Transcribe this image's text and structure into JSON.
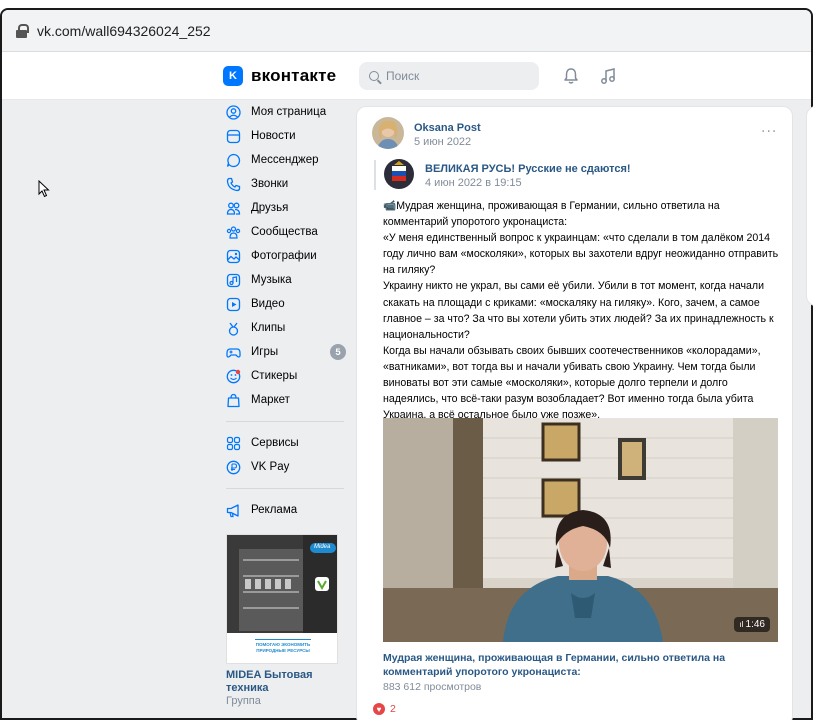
{
  "browser": {
    "url": "vk.com/wall694326024_252"
  },
  "header": {
    "logo_mark": "K",
    "logo_text": "вконтакте",
    "search_placeholder": "Поиск"
  },
  "sidebar": {
    "items": [
      {
        "label": "Моя страница",
        "icon": "user-circle-icon"
      },
      {
        "label": "Новости",
        "icon": "news-icon"
      },
      {
        "label": "Мессенджер",
        "icon": "chat-bubble-icon"
      },
      {
        "label": "Звонки",
        "icon": "phone-icon"
      },
      {
        "label": "Друзья",
        "icon": "friends-icon"
      },
      {
        "label": "Сообщества",
        "icon": "communities-icon"
      },
      {
        "label": "Фотографии",
        "icon": "photo-icon"
      },
      {
        "label": "Музыка",
        "icon": "music-icon"
      },
      {
        "label": "Видео",
        "icon": "video-icon"
      },
      {
        "label": "Клипы",
        "icon": "clips-icon"
      },
      {
        "label": "Игры",
        "icon": "gamepad-icon",
        "badge": "5"
      },
      {
        "label": "Стикеры",
        "icon": "sticker-icon"
      },
      {
        "label": "Маркет",
        "icon": "shopping-bag-icon"
      }
    ],
    "items2": [
      {
        "label": "Сервисы",
        "icon": "services-icon"
      },
      {
        "label": "VK Pay",
        "icon": "vkpay-icon"
      }
    ],
    "items3": [
      {
        "label": "Реклама",
        "icon": "megaphone-icon"
      }
    ],
    "ad": {
      "brand": "Midea",
      "slogan": "ПОМОГАЮ ЭКОНОМИТЬ ПРИРОДНЫЕ РЕСУРСЫ",
      "title": "MIDEA Бытовая техника",
      "subtitle": "Группа"
    }
  },
  "post": {
    "author": "Oksana Post",
    "date": "5 июн 2022",
    "more": "···",
    "repost": {
      "source": "ВЕЛИКАЯ РУСЬ! Русские не сдаются!",
      "date": "4 июн 2022 в 19:15"
    },
    "paragraphs": [
      "📹Мудрая женщина, проживающая в Германии, сильно ответила на комментарий упоротого укронациста:",
      "«У меня единственный вопрос к украинцам: «что сделали в том далёком 2014 году лично вам «москоляки», которых вы захотели вдруг неожиданно отправить на гиляку?",
      "Украину никто не украл, вы сами её убили. Убили в тот момент, когда начали скакать на площади с криками: «москаляку на гиляку». Кого, зачем, а самое главное – за что? За что вы хотели убить этих людей? За их принадлежность к национальности?",
      "Когда вы начали обзывать своих бывших соотечественников «колорадами», «ватниками», вот тогда вы и начали убивать свою Украину. Чем тогда были виноваты вот эти самые «москоляки», которые долго терпели и долго надеялись, что всё-таки разум возобладает? Вот именно тогда была убита Украина, а всё остальное было уже позже»."
    ],
    "video": {
      "duration": "1:46",
      "title": "Мудрая женщина, проживающая в Германии, сильно ответила на комментарий упоротого укронациста:",
      "views": "883 612 просмотров"
    },
    "likes": "2"
  },
  "colors": {
    "accent": "#0077ff",
    "link": "#2a5885",
    "muted": "#818c99",
    "like": "#e64646"
  }
}
